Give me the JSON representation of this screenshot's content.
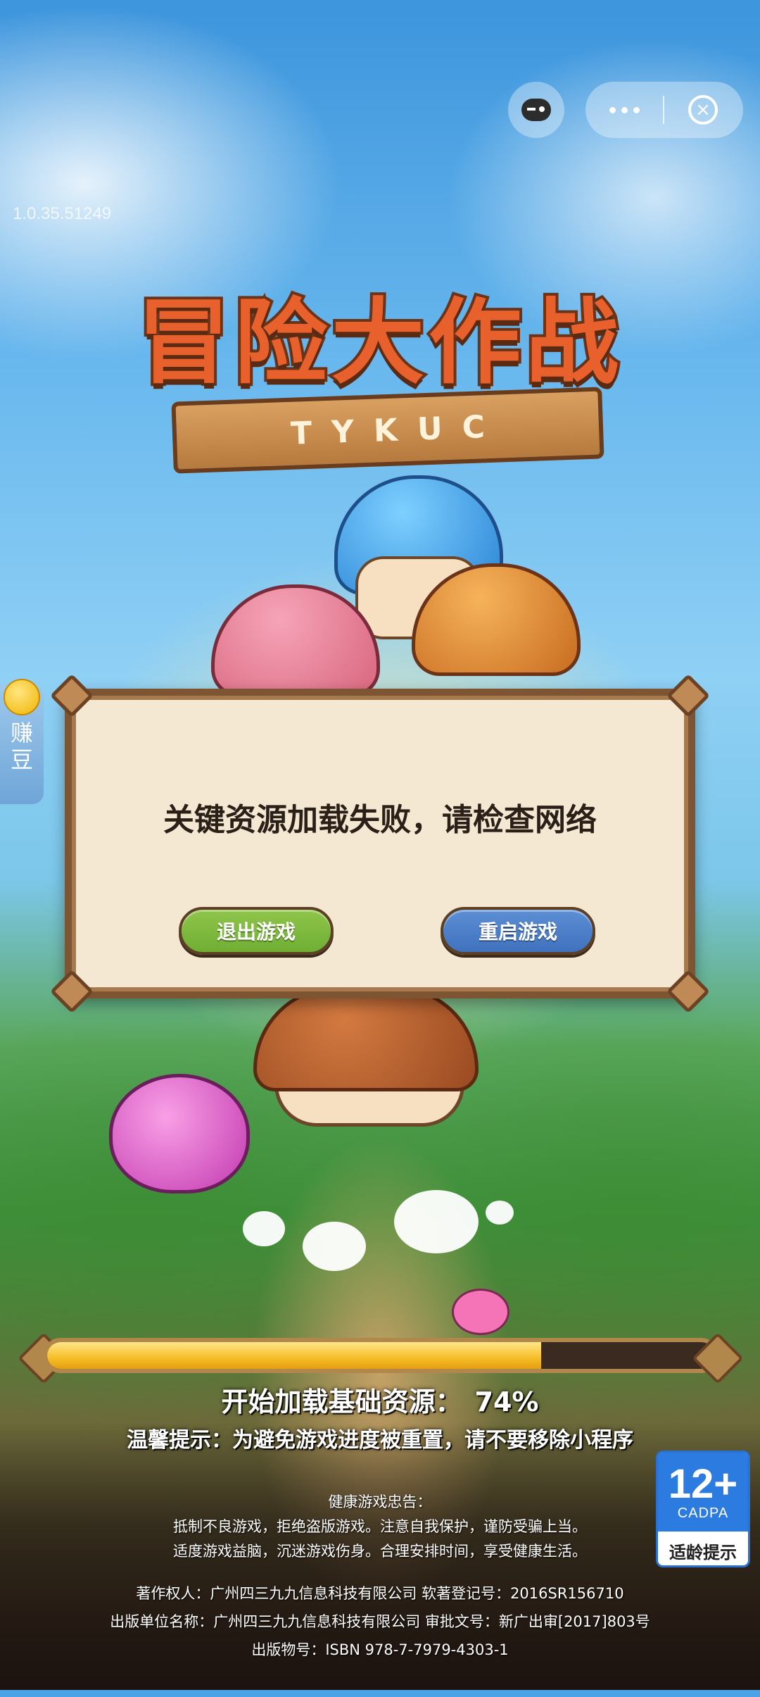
{
  "app": {
    "version": "1.0.35.51249",
    "logo_title": "冒险大作战",
    "logo_plank_glyphs": [
      "T",
      "Y",
      "K",
      "U",
      "C"
    ]
  },
  "capsule": {
    "gamepad_icon": "gamepad-icon",
    "more_icon": "more-dots-icon",
    "close_icon": "close-circle-icon",
    "close_glyph": "×"
  },
  "side_tab": {
    "label": "赚豆",
    "icon": "coin-icon"
  },
  "dialog": {
    "message": "关键资源加载失败，请检查网络",
    "exit_button": "退出游戏",
    "restart_button": "重启游戏",
    "exit_color": "#6fae34",
    "restart_color": "#3f71bd"
  },
  "loading": {
    "label": "开始加载基础资源：",
    "percent_text": "74%",
    "progress": 0.74,
    "tip": "温馨提示：为避免游戏进度被重置，请不要移除小程序"
  },
  "health_notice": {
    "title": "健康游戏忠告：",
    "line1": "抵制不良游戏，拒绝盗版游戏。注意自我保护，谨防受骗上当。",
    "line2": "适度游戏益脑，沉迷游戏伤身。合理安排时间，享受健康生活。"
  },
  "credits": {
    "copyright": "著作权人：广州四三九九信息科技有限公司   软著登记号：2016SR156710",
    "publisher": "出版单位名称：广州四三九九信息科技有限公司   审批文号：新广出审[2017]803号",
    "isbn": "出版物号：ISBN 978-7-7979-4303-1"
  },
  "age_rating": {
    "age": "12+",
    "org": "CADPA",
    "tip": "适龄提示",
    "color": "#2b7be0"
  }
}
